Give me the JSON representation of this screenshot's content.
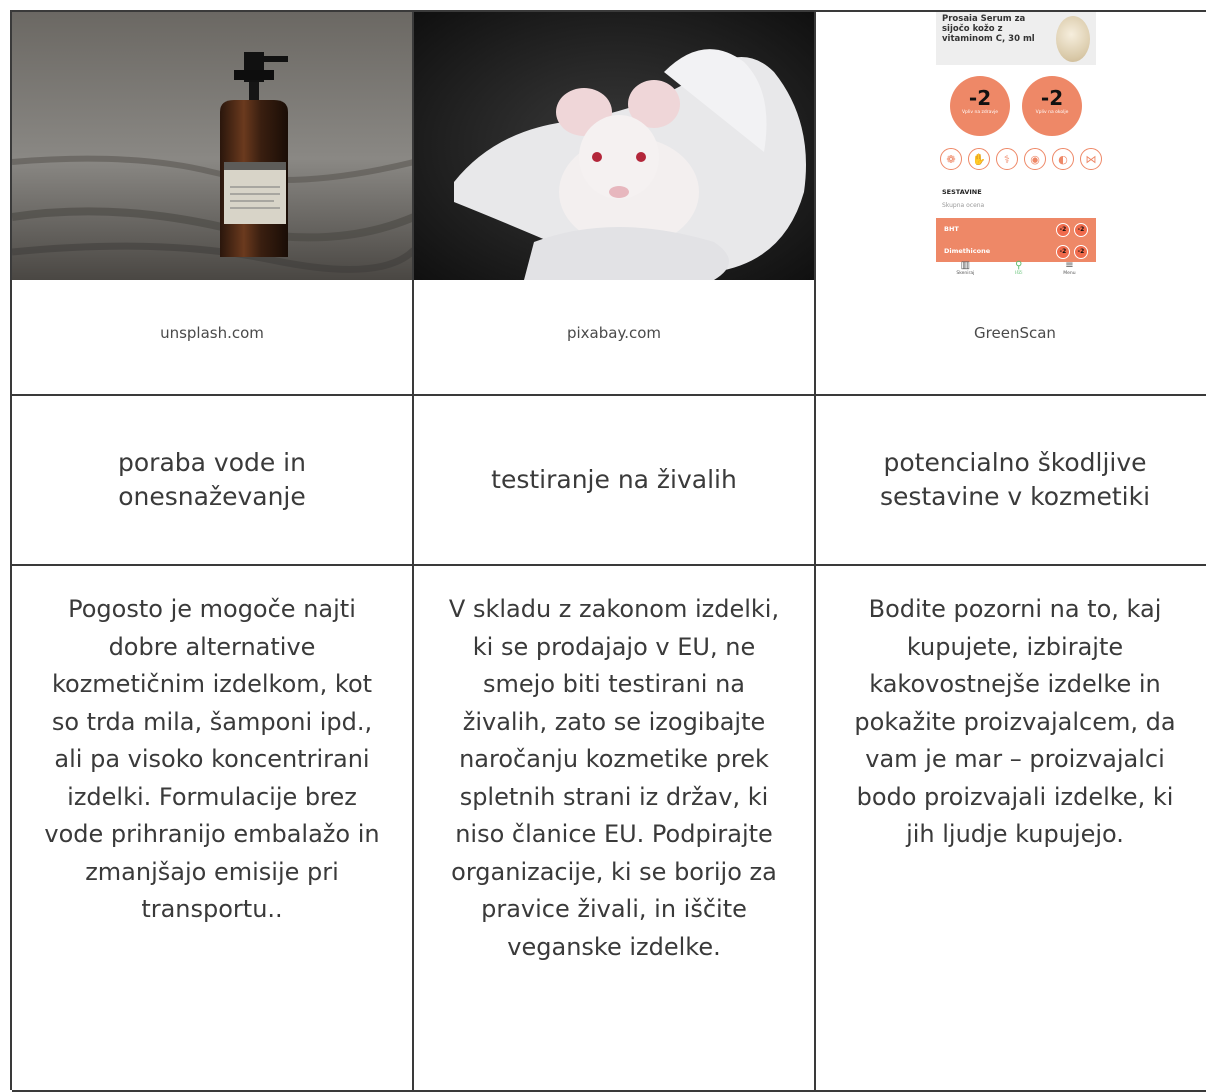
{
  "columns": [
    {
      "source": "unsplash.com",
      "title": "poraba vode in onesnaževanje",
      "body": "Pogosto je mogoče najti dobre alternative kozmetičnim izdelkom, kot so trda mila, šamponi ipd., ali pa visoko koncentrirani izdelki. Formulacije brez vode prihranijo embalažo in zmanjšajo emisije pri transportu.."
    },
    {
      "source": "pixabay.com",
      "title": "testiranje na živalih",
      "body": "V skladu z zakonom izdelki, ki se prodajajo v EU, ne smejo biti testirani na živalih, zato se izogibajte naročanju kozmetike prek spletnih strani iz držav, ki niso članice EU. Podpirajte organizacije, ki se borijo za pravice živali, in iščite veganske izdelke."
    },
    {
      "source": "GreenScan",
      "title": "potencialno škodljive sestavine v kozmetiki",
      "body": "Bodite pozorni na to, kaj kupujete, izbirajte kakovostnejše izdelke in pokažite proizvajalcem, da vam je mar – proizvajalci bodo proizvajali izdelke, ki jih ljudje kupujejo."
    }
  ],
  "phone": {
    "product": "Prosaia Serum za sijočo kožo z vitaminom C, 30 ml",
    "score_a": "-2",
    "score_a_label": "Vpliv na zdravje",
    "score_b": "-2",
    "score_b_label": "Vpliv na okolje",
    "section": "SESTAVINE",
    "subsection": "Skupna ocena",
    "ingredients": [
      "BHT",
      "Dimethicone"
    ],
    "ing_score": "-2",
    "nav": [
      "Skeniraj",
      "Išči",
      "Menu"
    ],
    "accent": "#ee8867"
  }
}
